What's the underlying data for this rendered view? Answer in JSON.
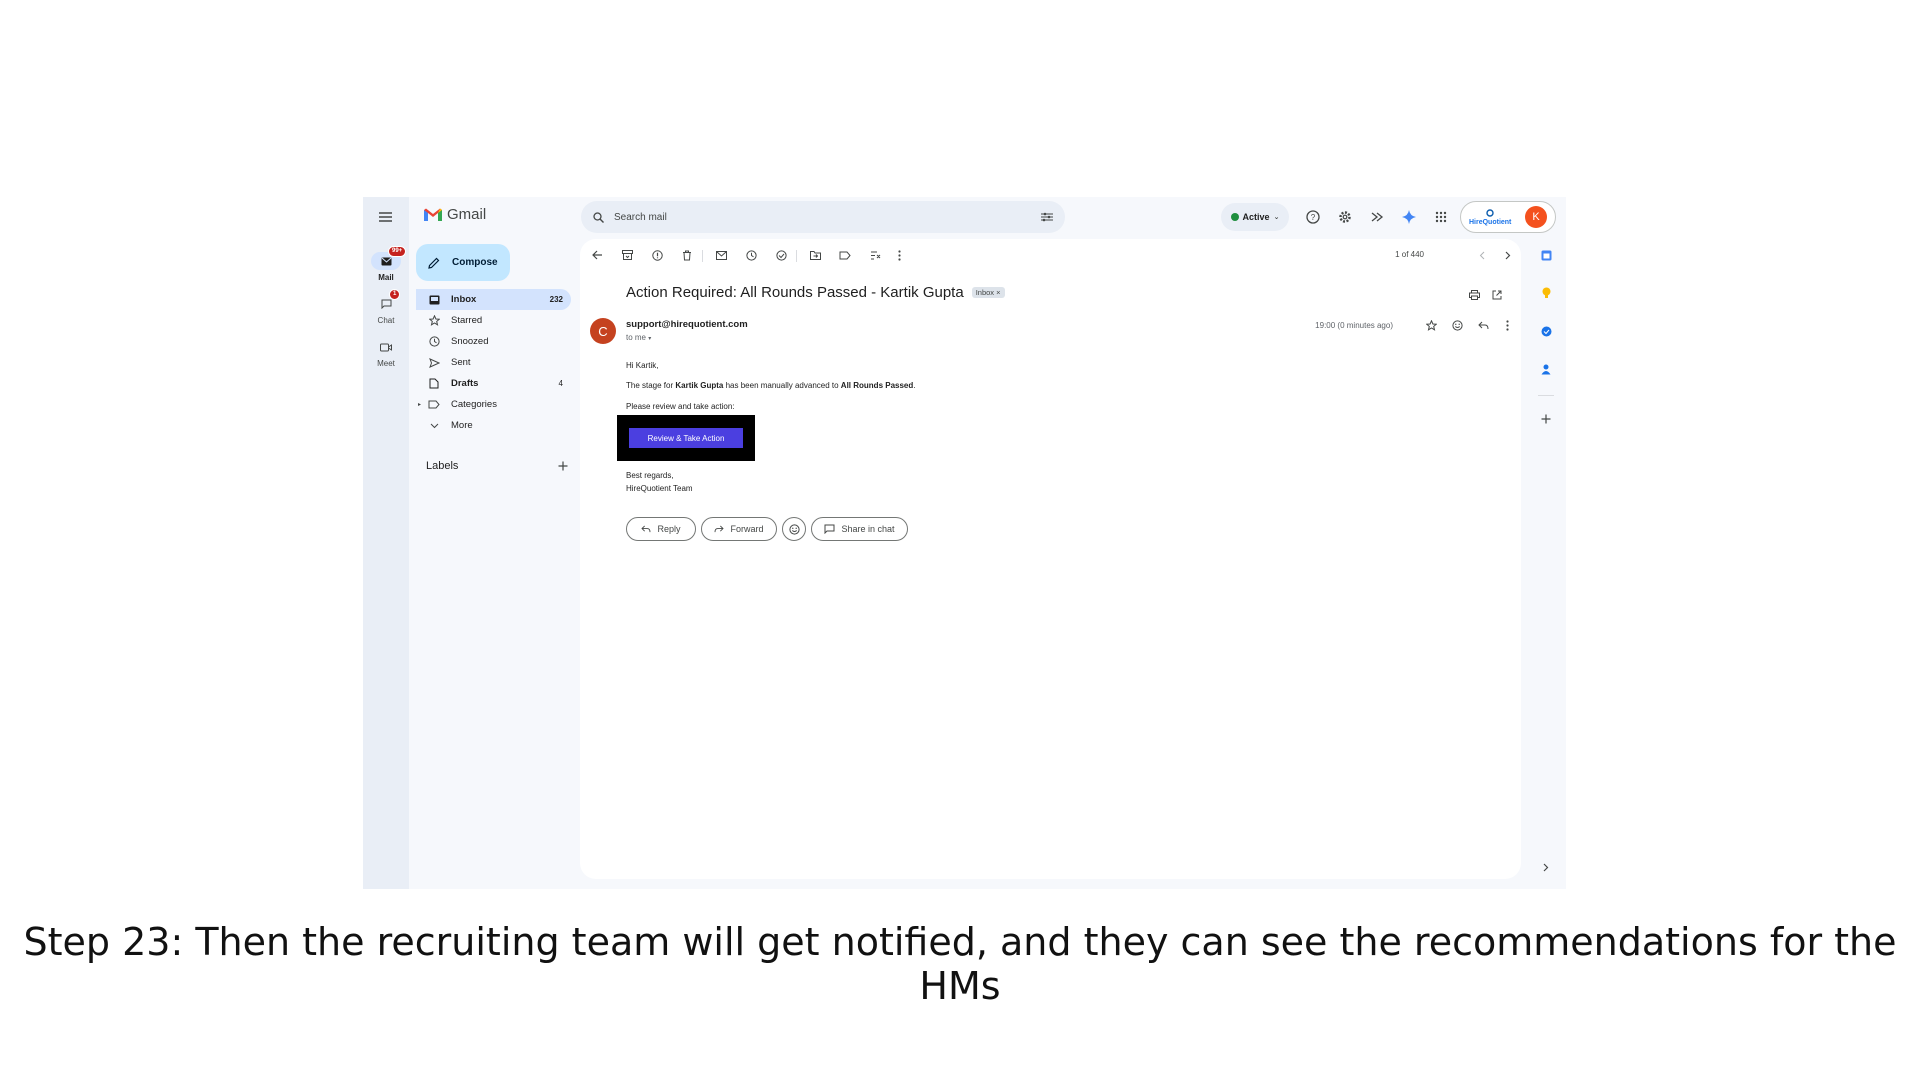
{
  "app": {
    "name": "Gmail",
    "search_placeholder": "Search mail",
    "status": "Active",
    "account_initial": "K",
    "org_logo_text": "HireQuotient"
  },
  "rail": [
    {
      "label": "Mail",
      "badge": "99+",
      "icon": "mail-icon",
      "active": true
    },
    {
      "label": "Chat",
      "badge": "1",
      "icon": "chat-icon",
      "active": false
    },
    {
      "label": "Meet",
      "badge": "",
      "icon": "video-icon",
      "active": false
    }
  ],
  "compose_label": "Compose",
  "nav": [
    {
      "label": "Inbox",
      "count": "232",
      "icon": "inbox-icon"
    },
    {
      "label": "Starred",
      "count": "",
      "icon": "star-icon"
    },
    {
      "label": "Snoozed",
      "count": "",
      "icon": "clock-icon"
    },
    {
      "label": "Sent",
      "count": "",
      "icon": "send-icon"
    },
    {
      "label": "Drafts",
      "count": "4",
      "icon": "draft-icon"
    },
    {
      "label": "Categories",
      "count": "",
      "icon": "label-icon"
    },
    {
      "label": "More",
      "count": "",
      "icon": "chevron-down-icon"
    }
  ],
  "labels_heading": "Labels",
  "toolbar": {
    "pager": "1 of 440"
  },
  "email": {
    "subject": "Action Required: All Rounds Passed - Kartik Gupta",
    "chip": "Inbox",
    "sender_initial": "C",
    "sender": "support@hirequotient.com",
    "to": "to me",
    "time": "19:00 (0 minutes ago)",
    "greeting": "Hi Kartik,",
    "line_prefix": "The stage for ",
    "candidate": "Kartik Gupta",
    "line_middle": " has been manually advanced to ",
    "stage": "All Rounds Passed",
    "line_suffix": ".",
    "prompt": "Please review and take action:",
    "cta": "Review & Take Action",
    "signoff": "Best regards,",
    "team": "HireQuotient Team"
  },
  "actions": {
    "reply": "Reply",
    "forward": "Forward",
    "share": "Share in chat"
  },
  "caption": "Step 23: Then the recruiting team will get notified, and they can see the recommendations for the HMs"
}
